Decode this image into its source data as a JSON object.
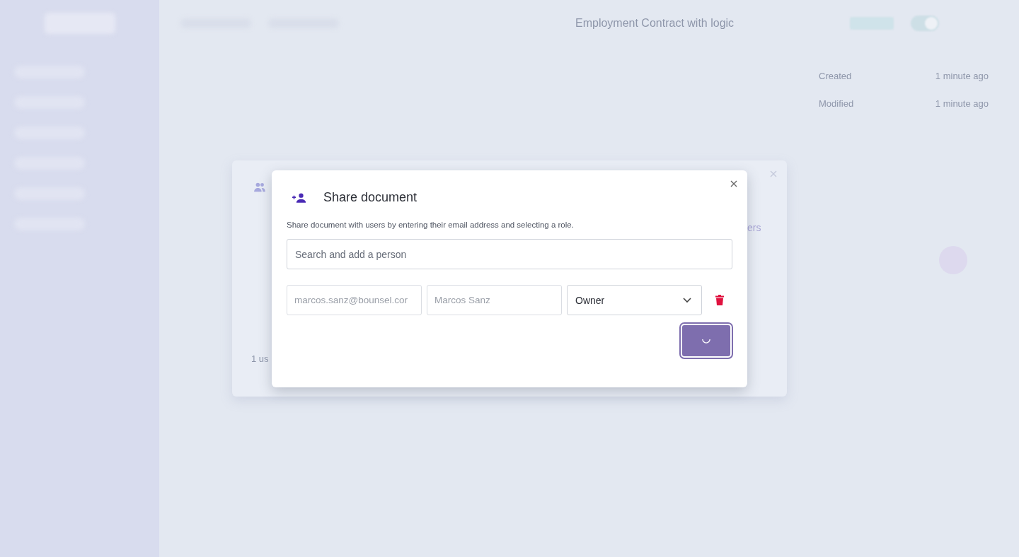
{
  "background": {
    "document_title": "Employment Contract with logic",
    "toggle": {
      "on": true
    },
    "properties": [
      {
        "label": "Created",
        "value": "1 minute ago"
      },
      {
        "label": "Modified",
        "value": "1 minute ago"
      }
    ]
  },
  "members_dialog": {
    "link_fragment": "ers",
    "footer_fragment": "1 us"
  },
  "share_dialog": {
    "title": "Share document",
    "description": "Share document with users by entering their email address and selecting a role.",
    "search": {
      "placeholder": "Search and add a person"
    },
    "invites": [
      {
        "email": "marcos.sanz@bounsel.cor",
        "name": "Marcos Sanz",
        "role": "Owner"
      }
    ],
    "submit": {
      "loading": true
    }
  }
}
